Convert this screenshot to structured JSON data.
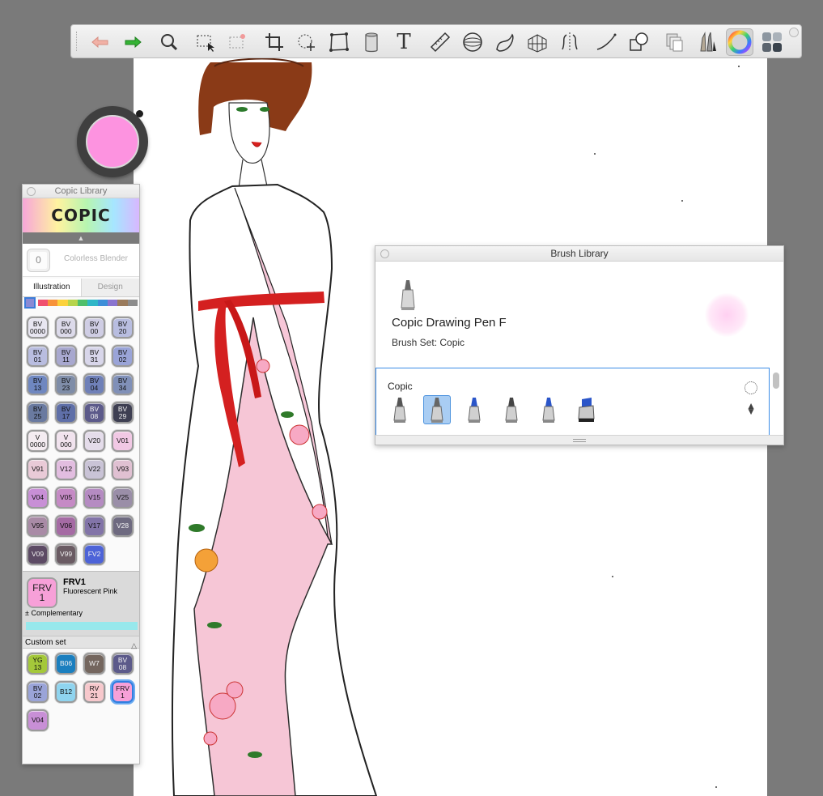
{
  "toolbar": {
    "tools": [
      {
        "name": "undo-icon"
      },
      {
        "name": "redo-icon"
      },
      {
        "name": "magnifier-icon"
      },
      {
        "name": "selection-icon"
      },
      {
        "name": "magic-wand-icon"
      },
      {
        "name": "crop-icon"
      },
      {
        "name": "transform-icon"
      },
      {
        "name": "distort-icon"
      },
      {
        "name": "fill-bucket-icon"
      },
      {
        "name": "text-icon"
      },
      {
        "name": "ruler-icon"
      },
      {
        "name": "ellipse-guide-icon"
      },
      {
        "name": "curve-icon"
      },
      {
        "name": "perspective-icon"
      },
      {
        "name": "symmetry-icon"
      },
      {
        "name": "stroke-icon"
      },
      {
        "name": "shapes-icon"
      },
      {
        "name": "layers-icon"
      },
      {
        "name": "brush-library-icon"
      },
      {
        "name": "color-wheel-icon"
      },
      {
        "name": "copic-library-icon"
      }
    ],
    "text_tool_glyph": "T"
  },
  "color_puck": {
    "color": "#fd93e0"
  },
  "copic_library": {
    "title": "Copic Library",
    "logo": "COPIC",
    "colorless_blender": {
      "code": "0",
      "label": "Colorless Blender"
    },
    "tabs": [
      {
        "label": "Illustration",
        "active": true
      },
      {
        "label": "Design",
        "active": false
      }
    ],
    "hue_strip_colors": [
      "#f0506e",
      "#f7923a",
      "#fbd13c",
      "#b6d44b",
      "#4fbf6b",
      "#2fb6c7",
      "#3d8ed8",
      "#8a74cf",
      "#9a7b5c",
      "#8c8c8c"
    ],
    "markers": [
      {
        "code": "BV\n0000",
        "color": "#e8e6f1"
      },
      {
        "code": "BV\n000",
        "color": "#dcdaea"
      },
      {
        "code": "BV\n00",
        "color": "#cfcde4"
      },
      {
        "code": "BV\n20",
        "color": "#b8bde0"
      },
      {
        "code": "BV\n01",
        "color": "#b9bde0"
      },
      {
        "code": "BV\n11",
        "color": "#a8a8cf"
      },
      {
        "code": "BV\n31",
        "color": "#d8d6ea"
      },
      {
        "code": "BV\n02",
        "color": "#9aa4d8"
      },
      {
        "code": "BV\n13",
        "color": "#6f87c0"
      },
      {
        "code": "BV\n23",
        "color": "#7f8da8"
      },
      {
        "code": "BV\n04",
        "color": "#6f80b8"
      },
      {
        "code": "BV\n34",
        "color": "#8090b8"
      },
      {
        "code": "BV\n25",
        "color": "#6a7aa0"
      },
      {
        "code": "BV\n17",
        "color": "#5f6fa8"
      },
      {
        "code": "BV\n08",
        "color": "#5c5a8a"
      },
      {
        "code": "BV\n29",
        "color": "#3e3f52"
      },
      {
        "code": "V\n0000",
        "color": "#f4ecf1"
      },
      {
        "code": "V\n000",
        "color": "#f1e3ee"
      },
      {
        "code": "V20",
        "color": "#e4dcea"
      },
      {
        "code": "V01",
        "color": "#f1c8e4"
      },
      {
        "code": "V91",
        "color": "#e9cad7"
      },
      {
        "code": "V12",
        "color": "#e2bde0"
      },
      {
        "code": "V22",
        "color": "#c9c3d6"
      },
      {
        "code": "V93",
        "color": "#e0c0d2"
      },
      {
        "code": "V04",
        "color": "#c88fd6"
      },
      {
        "code": "V05",
        "color": "#c58ac5"
      },
      {
        "code": "V15",
        "color": "#b58bc2"
      },
      {
        "code": "V25",
        "color": "#9a8ea8"
      },
      {
        "code": "V95",
        "color": "#a98ba6"
      },
      {
        "code": "V06",
        "color": "#a56ba4"
      },
      {
        "code": "V17",
        "color": "#8274a8"
      },
      {
        "code": "V28",
        "color": "#6e6a80"
      },
      {
        "code": "V09",
        "color": "#5c4a64"
      },
      {
        "code": "V99",
        "color": "#6a5b63"
      },
      {
        "code": "FV2",
        "color": "#4d63d8"
      }
    ],
    "current": {
      "code_chip": "FRV\n1",
      "code": "FRV1",
      "name": "Fluorescent Pink",
      "color": "#f7a0d8",
      "complementary_label": "Complementary",
      "complementary_color": "#97e8ec"
    },
    "custom_set": {
      "label": "Custom set",
      "markers": [
        {
          "code": "YG\n13",
          "color": "#a4c83a"
        },
        {
          "code": "B06",
          "color": "#1b7fbf"
        },
        {
          "code": "W7",
          "color": "#74665e"
        },
        {
          "code": "BV\n08",
          "color": "#5c5a8a"
        },
        {
          "code": "BV\n02",
          "color": "#9aa4d8"
        },
        {
          "code": "B12",
          "color": "#8fd4ef"
        },
        {
          "code": "RV\n21",
          "color": "#f7c8cc"
        },
        {
          "code": "FRV\n1",
          "color": "#f7a0d8",
          "selected": true
        },
        {
          "code": "V04",
          "color": "#c88fd6"
        }
      ]
    }
  },
  "brush_library": {
    "title": "Brush Library",
    "brush_name": "Copic Drawing Pen F",
    "brush_set": "Brush Set: Copic",
    "set_name": "Copic",
    "brushes": [
      {
        "name": "copic-drawing-pen-icon",
        "tip": "#555555",
        "selected": false
      },
      {
        "name": "copic-drawing-pen-f-icon",
        "tip": "#666666",
        "selected": true
      },
      {
        "name": "copic-brush-icon",
        "tip": "#2a55c9",
        "selected": false
      },
      {
        "name": "copic-round-icon",
        "tip": "#444444",
        "selected": false
      },
      {
        "name": "copic-fine-icon",
        "tip": "#2a55c9",
        "selected": false
      },
      {
        "name": "copic-wide-icon",
        "tip": "#2a55c9",
        "selected": false
      }
    ]
  }
}
